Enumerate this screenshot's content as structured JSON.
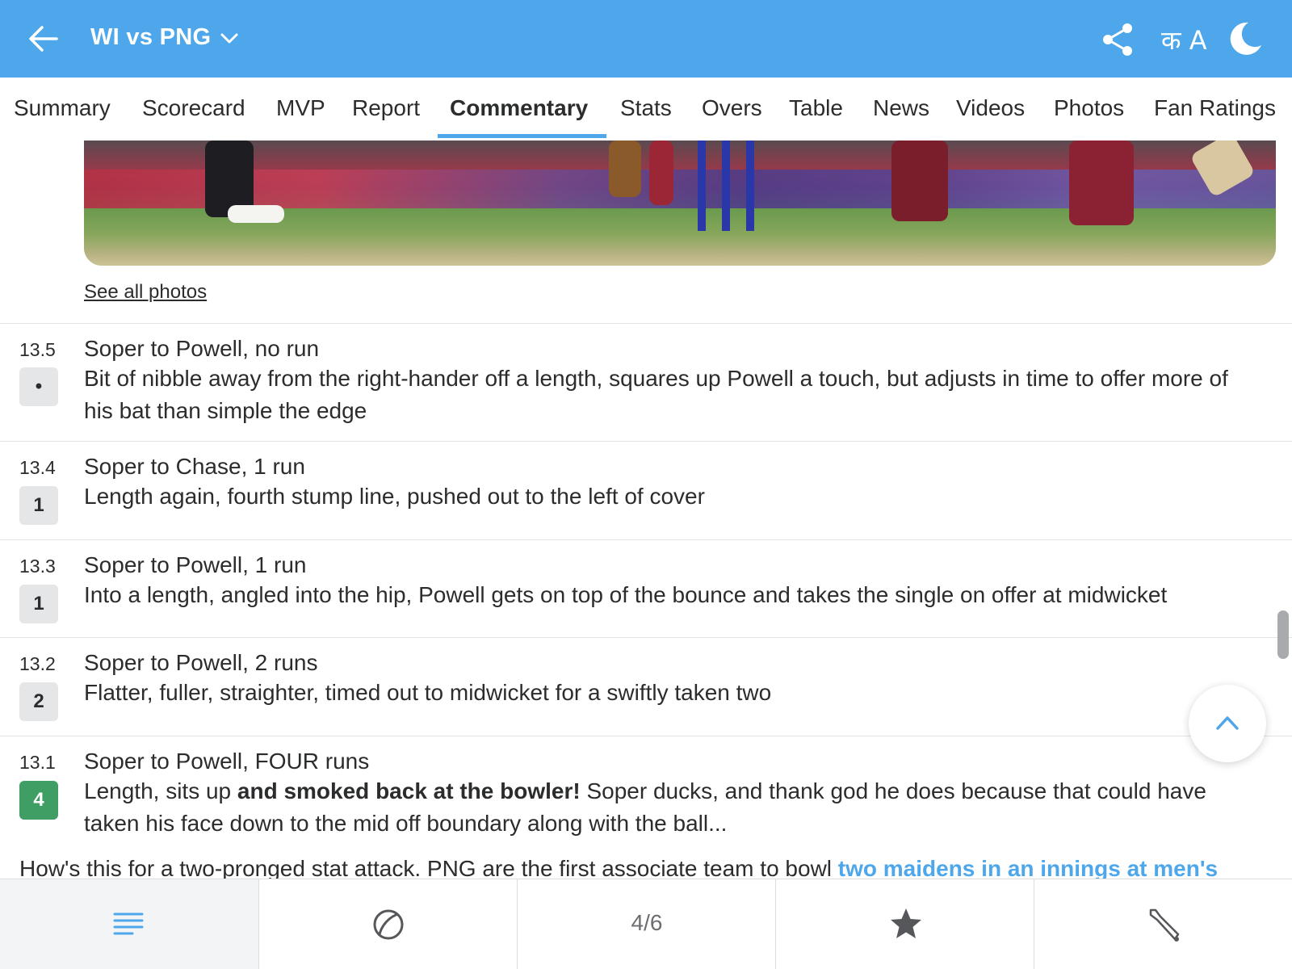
{
  "header": {
    "title": "WI vs PNG",
    "language_label": "क A",
    "icons": [
      "back-arrow-icon",
      "chevron-down-icon",
      "share-icon",
      "language-icon",
      "moon-icon"
    ],
    "background_color": "#4da7ea"
  },
  "tabs": [
    {
      "label": "Summary"
    },
    {
      "label": "Scorecard"
    },
    {
      "label": "MVP"
    },
    {
      "label": "Report"
    },
    {
      "label": "Commentary",
      "active": true
    },
    {
      "label": "Stats"
    },
    {
      "label": "Overs"
    },
    {
      "label": "Table"
    },
    {
      "label": "News"
    },
    {
      "label": "Videos"
    },
    {
      "label": "Photos"
    },
    {
      "label": "Fan Ratings"
    }
  ],
  "photos": {
    "see_all_label": "See all photos"
  },
  "commentary": [
    {
      "over": "13.5",
      "ball": "•",
      "headline": "Soper to Powell, no run",
      "text": "Bit of nibble away from the right-hander off a length, squares up Powell a touch, but adjusts in time to offer more of his bat than simple the edge"
    },
    {
      "over": "13.4",
      "ball": "1",
      "headline": "Soper to Chase, 1 run",
      "text": "Length again, fourth stump line, pushed out to the left of cover"
    },
    {
      "over": "13.3",
      "ball": "1",
      "headline": "Soper to Powell, 1 run",
      "text": "Into a length, angled into the hip, Powell gets on top of the bounce and takes the single on offer at midwicket"
    },
    {
      "over": "13.2",
      "ball": "2",
      "headline": "Soper to Powell, 2 runs",
      "text": "Flatter, fuller, straighter, timed out to midwicket for a swiftly taken two"
    },
    {
      "over": "13.1",
      "ball": "4",
      "headline": "Soper to Powell, FOUR runs",
      "text_before": "Length, sits up ",
      "text_bold": "and smoked back at the bowler!",
      "text_after": " Soper ducks, and thank god he does because that could have taken his face down to the mid off boundary along with the ball..."
    }
  ],
  "cutoff_text": {
    "plain": "How's this for a two-pronged stat attack. PNG are the first associate team to bowl ",
    "link": "two maidens in an innings at men's"
  },
  "bottom_bar": {
    "page_indicator": "4/6",
    "icons": [
      "menu-icon",
      "ball-icon",
      "star-icon",
      "bat-icon"
    ]
  },
  "colors": {
    "accent": "#4da7ea",
    "four_badge": "#3f9e63",
    "ball_badge": "#e5e6e7"
  }
}
